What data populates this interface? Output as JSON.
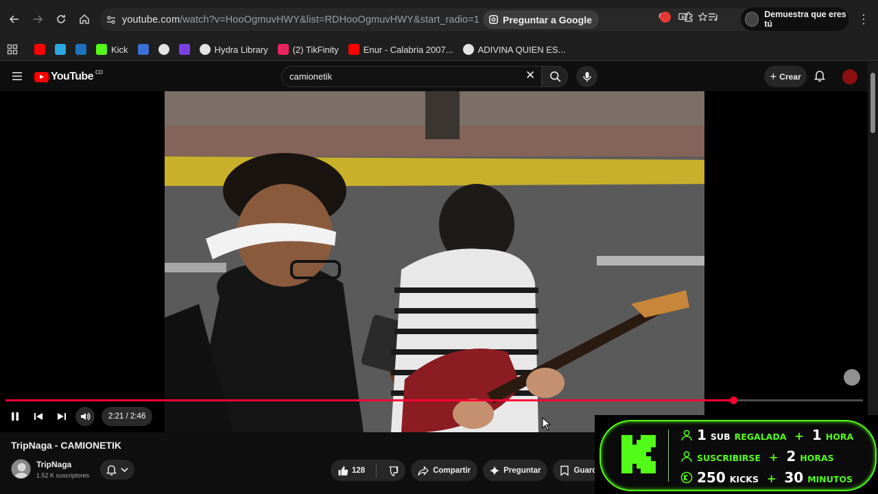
{
  "browser": {
    "url_host": "youtube.com",
    "url_path": "/watch?v=HooOgmuvHWY&list=RDHooOgmuvHWY&start_radio=1",
    "ask_google_label": "Preguntar a Google",
    "profile_label": "Demuestra que eres tú"
  },
  "bookmarks": [
    {
      "label": "",
      "icon": "youtube-icon",
      "color": "#ff0000"
    },
    {
      "label": "",
      "icon": "tl-icon",
      "color": "#2aa8e0"
    },
    {
      "label": "",
      "icon": "paypal-icon",
      "color": "#1e73be"
    },
    {
      "label": "Kick",
      "icon": "kick-icon",
      "color": "#53fc18"
    },
    {
      "label": "",
      "icon": "blue-square-icon",
      "color": "#3b6fd4"
    },
    {
      "label": "",
      "icon": "globe-icon",
      "color": "#e3e3e3"
    },
    {
      "label": "",
      "icon": "purple-app-icon",
      "color": "#7b3fe4"
    },
    {
      "label": "Hydra Library",
      "icon": "hydra-icon",
      "color": "#e3e3e3"
    },
    {
      "label": "(2) TikFinity",
      "icon": "tikfinity-icon",
      "color": "#e6265c"
    },
    {
      "label": "Enur - Calabria 2007...",
      "icon": "youtube-icon",
      "color": "#ff0000"
    },
    {
      "label": "ADIVINA QUIEN ES...",
      "icon": "globe-icon",
      "color": "#e3e3e3"
    }
  ],
  "youtube": {
    "logo_text": "YouTube",
    "country_code": "CO",
    "search_value": "camionetik",
    "create_label": "Crear"
  },
  "player": {
    "time": "2:21 / 2:46",
    "progress_fraction": 0.849
  },
  "video": {
    "title": "TripNaga - CAMIONETIK",
    "channel": "TripNaga",
    "subscribers": "1.52 K suscriptores",
    "likes": "128",
    "share_label": "Compartir",
    "ask_label": "Preguntar",
    "save_label": "Guardar"
  },
  "kick_overlay": {
    "accent": "#53fc18",
    "row1": {
      "num": "1",
      "word1": "SUB",
      "word2": "REGALADA",
      "num2": "1",
      "unit": "HORA"
    },
    "row2": {
      "word": "SUSCRIBIRSE",
      "num2": "2",
      "unit": "HORAS"
    },
    "row3": {
      "num": "250",
      "word": "KICKS",
      "num2": "30",
      "unit": "MINUTOS"
    }
  }
}
